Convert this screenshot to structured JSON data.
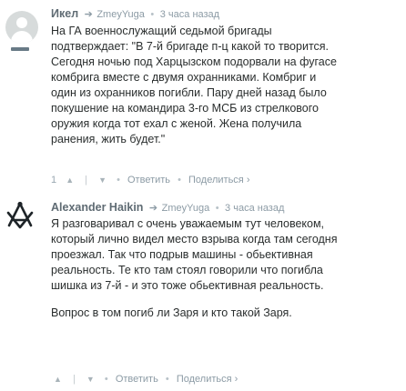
{
  "comments": [
    {
      "author": "Икел",
      "reply_to": "ZmeyYuga",
      "time": "3 часа назад",
      "lines": [
        "На ГА военнослужащий седьмой бригады",
        "подтверждает: \"В 7-й бригаде п-ц какой то творится.",
        "Сегодня ночью под Харцызском подорвали на фугасе",
        "комбрига вместе с двумя охранниками. Комбриг и",
        "один из охранников погибли. Пару дней назад было",
        "покушение на командира 3-го МСБ из стрелкового",
        "оружия когда тот ехал с женой. Жена получила",
        "ранения, жить будет.\""
      ],
      "votes": "1",
      "reply_label": "Ответить",
      "share_label": "Поделиться"
    },
    {
      "author": "Alexander Haikin",
      "reply_to": "ZmeyYuga",
      "time": "3 часа назад",
      "lines": [
        "Я разговаривал с очень уважаемым тут человеком,",
        "который лично видел место взрыва когда там сегодня",
        "проезжал. Так что подрыв машины - обьективная",
        "реальность. Те кто там стоял говорили что погибла",
        "шишка из 7-й - и это тоже обьективная реальность."
      ],
      "extra_line": "Вопрос в том погиб ли Заря и кто такой Заря.",
      "reply_label": "Ответить",
      "share_label": "Поделиться"
    }
  ],
  "icons": {
    "vote_up": "chevron-up-icon",
    "vote_down": "chevron-down-icon",
    "reply_arrow": "reply-arrow-icon",
    "share_arrow": "share-arrow-icon"
  },
  "colors": {
    "text": "#2a2e2e",
    "muted": "#8c9ba5",
    "author": "#5f6b73"
  }
}
